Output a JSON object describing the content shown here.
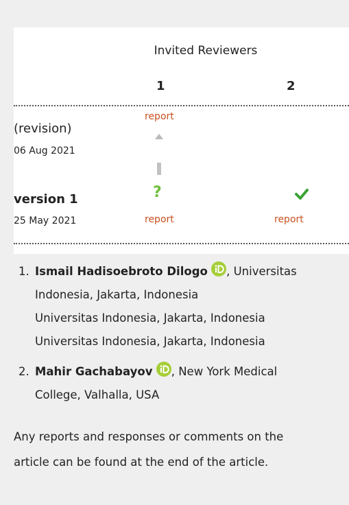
{
  "header": {
    "title": "Invited Reviewers",
    "reviewer_numbers": [
      "1",
      "2"
    ]
  },
  "versions": [
    {
      "label": "(revision)",
      "date": "06 Aug 2021",
      "reports": [
        {
          "reviewer": 1,
          "link": "report",
          "status_icon": "up-arrow-icon"
        }
      ]
    },
    {
      "label": "version 1",
      "date": "25 May 2021",
      "reports": [
        {
          "reviewer": 1,
          "link": "report",
          "status_icon": "question-mark-icon"
        },
        {
          "reviewer": 2,
          "link": "report",
          "status_icon": "approved-check-icon"
        }
      ]
    }
  ],
  "reviewers": [
    {
      "number": "1.",
      "name": "Ismail Hadisoebroto Dilogo",
      "affiliation_inline": ", Universitas",
      "affiliation_lines": [
        "Indonesia, Jakarta, Indonesia",
        "Universitas Indonesia, Jakarta, Indonesia",
        "Universitas Indonesia, Jakarta, Indonesia"
      ]
    },
    {
      "number": "2.",
      "name": "Mahir Gachabayov",
      "affiliation_inline": ", New York Medical",
      "affiliation_lines": [
        "College, Valhalla, USA"
      ]
    }
  ],
  "footer": {
    "line1": "Any reports and responses or comments on the",
    "line2": "article can be found at the end of the article."
  },
  "colors": {
    "link": "#c8501e",
    "orcid_green": "#a6ce39",
    "approved_green": "#3aa335",
    "question_green": "#6fbf3c"
  }
}
